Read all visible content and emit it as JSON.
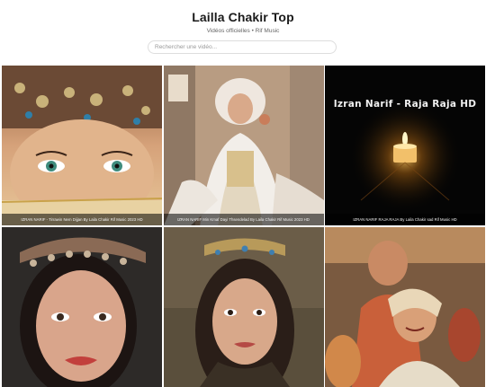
{
  "header": {
    "title": "Lailla Chakir Top",
    "subtitle": "Vidéos officielles • Rif Music"
  },
  "search": {
    "placeholder": "Rechercher une vidéo..."
  },
  "videos": [
    {
      "caption": "IZRAN NARIF - Tirrawin Nem Dijjan By Laila Chakir Rif Music 2023 HD"
    },
    {
      "caption": "IZRAN NARIF Min Kmaf Dayi Thsendelad By Laila Chakir Rif Music 2023 HD"
    },
    {
      "caption": "IZRAN NARIF RAJA RAJA By Laila Chakir sad Rif Music HD",
      "overlay_title": "Izran Narif - Raja Raja HD"
    },
    {
      "caption": ""
    },
    {
      "caption": ""
    },
    {
      "caption": ""
    }
  ]
}
